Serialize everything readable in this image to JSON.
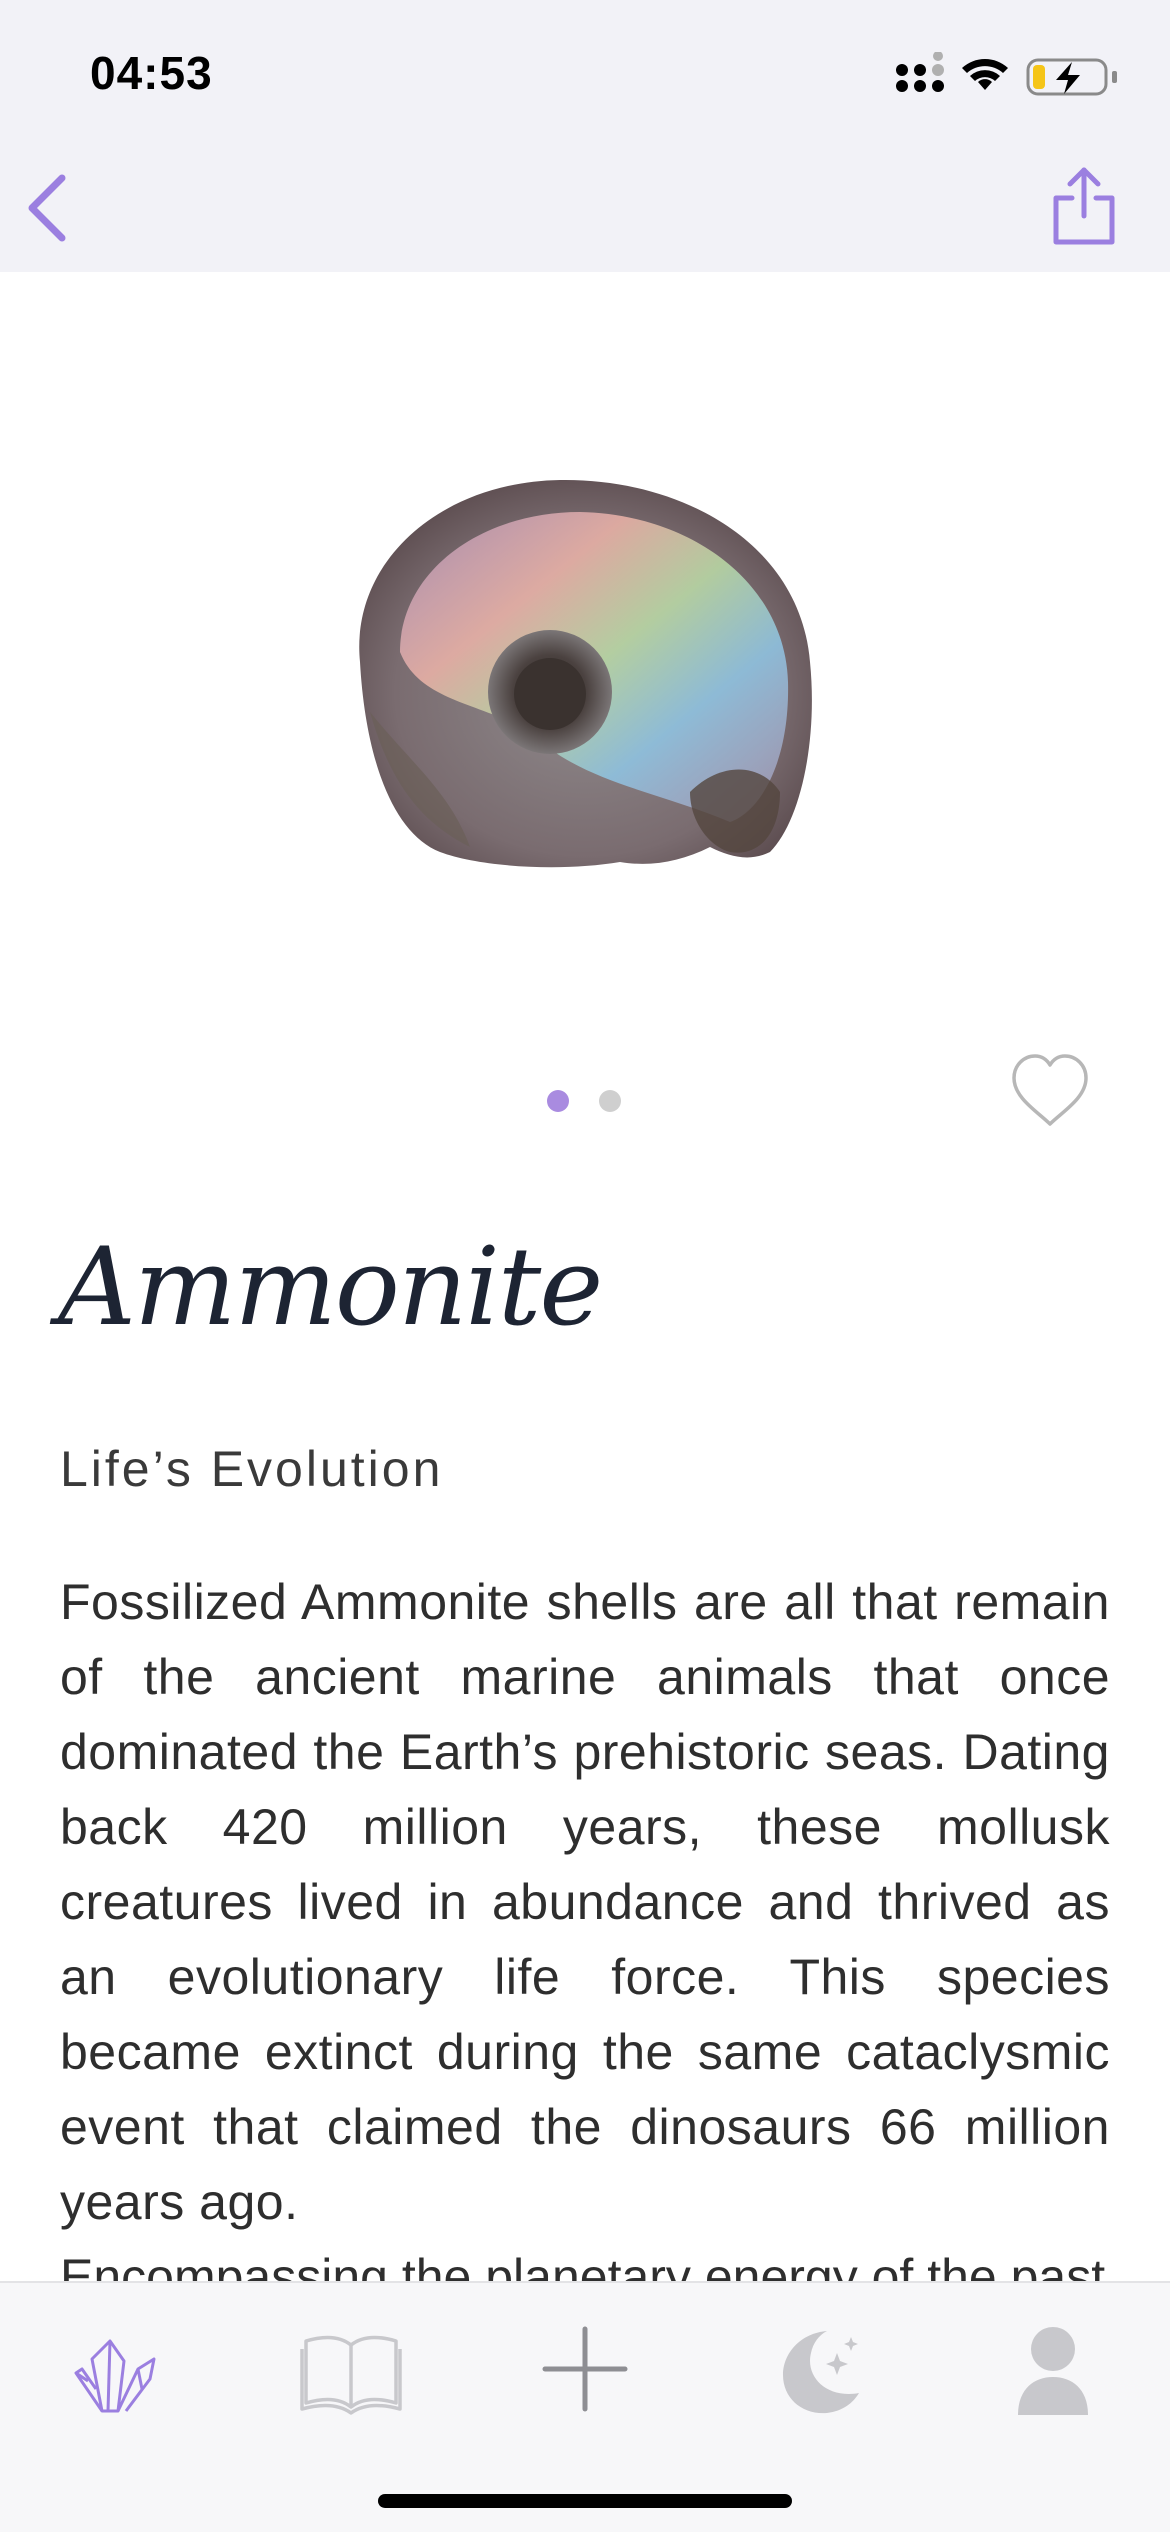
{
  "status": {
    "time": "04:53"
  },
  "colors": {
    "accent": "#9b7fe0",
    "title": "#1d2433",
    "inactive_icon": "#c8c8cc"
  },
  "nav": {
    "back_icon": "chevron-left-icon",
    "share_icon": "share-icon"
  },
  "hero": {
    "image": "ammonite-fossil-image",
    "pages": 2,
    "current_page": 1,
    "favorite_icon": "heart-icon"
  },
  "stone": {
    "name": "Ammonite",
    "tagline": "Life’s Evolution",
    "description": "Fossilized Ammonite shells are all that remain of the ancient marine animals that once dominated the Earth’s prehistoric seas. Dating back 420 million years, these mollusk creatures lived in abundance and thrived as an evolutionary life force. This species became extinct during the same cataclysmic event that claimed the dinosaurs 66 million years ago.",
    "description_next": "Encompassing the planetary energy of the past"
  },
  "tabs": [
    {
      "icon": "crystal-icon",
      "active": true
    },
    {
      "icon": "book-icon",
      "active": false
    },
    {
      "icon": "plus-icon",
      "active": false
    },
    {
      "icon": "moon-stars-icon",
      "active": false
    },
    {
      "icon": "profile-icon",
      "active": false
    }
  ]
}
